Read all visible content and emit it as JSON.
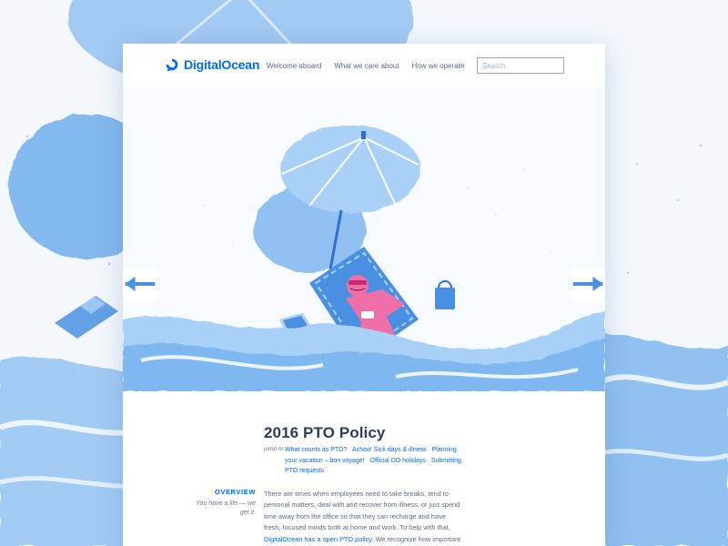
{
  "brand": {
    "name": "DigitalOcean",
    "color": "#0069ff"
  },
  "nav": {
    "items": [
      {
        "label": "Welcome aboard"
      },
      {
        "label": "What we care about"
      },
      {
        "label": "How we operate"
      }
    ]
  },
  "search": {
    "placeholder": "Search",
    "value": ""
  },
  "hero": {
    "icons": {
      "prev": "arrow-left-icon",
      "next": "arrow-right-icon"
    }
  },
  "article": {
    "title": "2016 PTO Policy",
    "jump_label": "jump to",
    "jump_links": [
      "What counts as PTO?",
      "Achoo! Sick days & illness",
      "Planning your vacation – bon voyage!",
      "Official DO holidays",
      "Submitting PTO requests"
    ],
    "overview_label": "OVERVIEW",
    "overview_sub": "You have a life — we get it.",
    "body_text": "There are times when employees need to take breaks, tend to personal matters, deal with and recover from illness, or just spend time away from the office so that they can recharge and have fresh, focused minds both at home and work. To help with that,",
    "body_link": "DigitalOcean has a open PTO policy.",
    "body_tail": "We recognize how important"
  },
  "colors": {
    "accent": "#0069ff",
    "water": "#7fb8f0",
    "water_dark": "#3f8fe6",
    "sand": "#f4f8fd",
    "towel": "#4a90e2",
    "character": "#f06fa8"
  }
}
